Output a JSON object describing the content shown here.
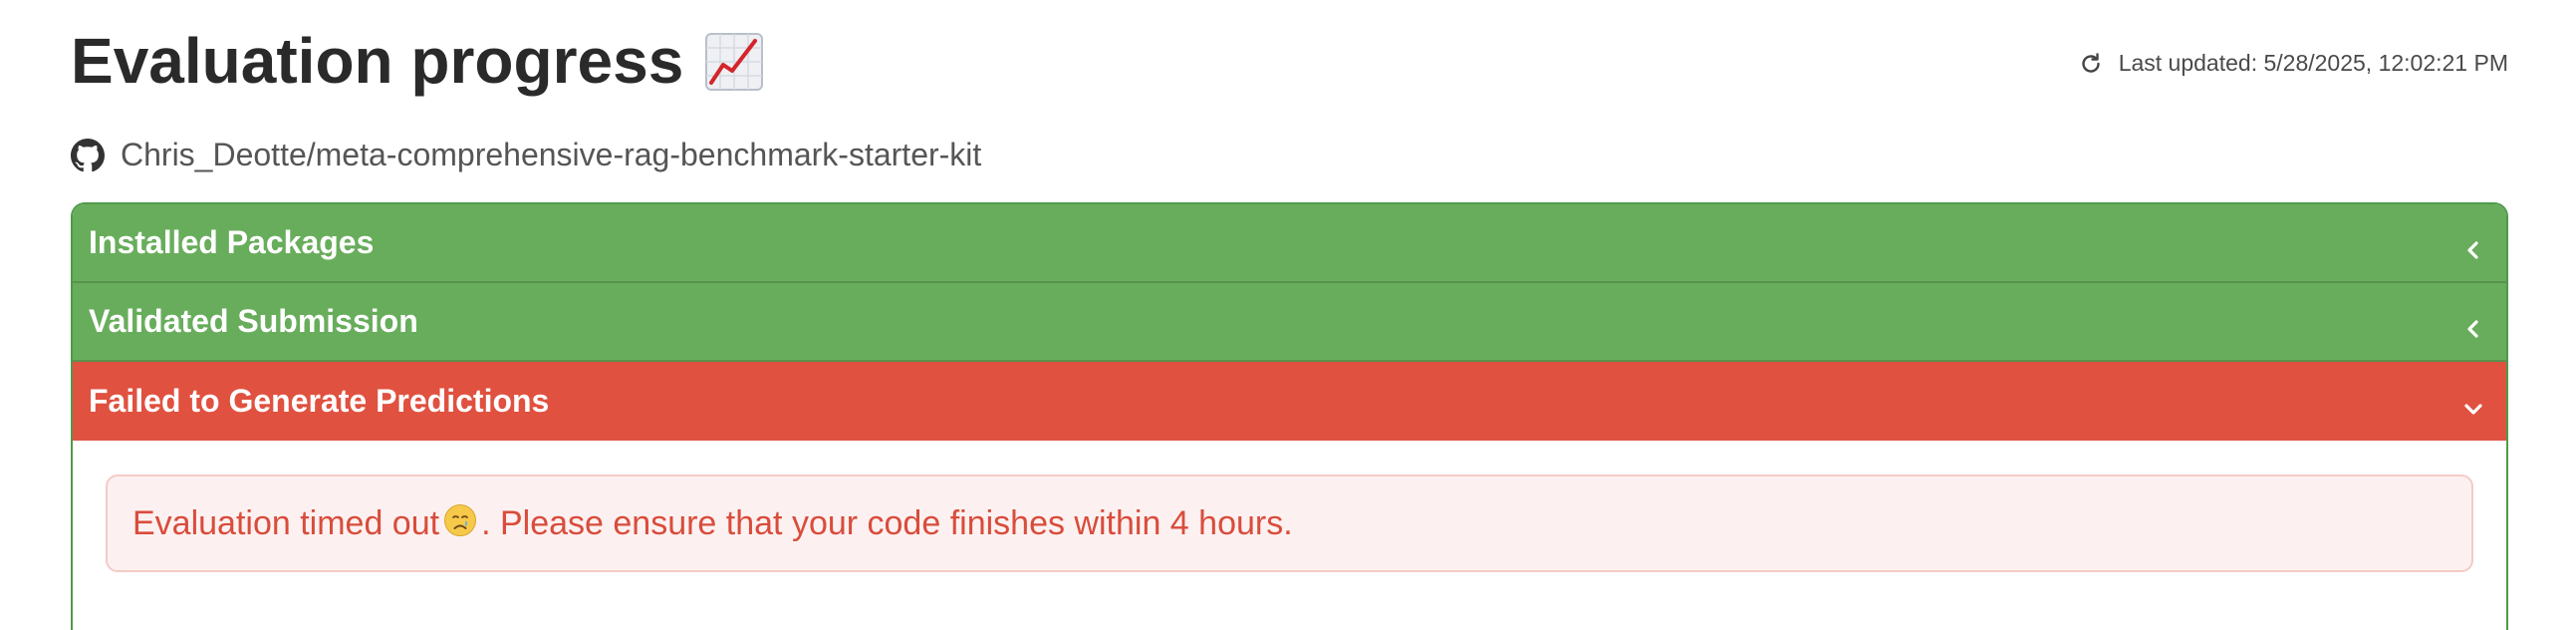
{
  "header": {
    "title": "Evaluation progress",
    "title_icon": "chart-increasing-icon",
    "last_updated_label": "Last updated: 5/28/2025, 12:02:21 PM"
  },
  "repo": {
    "icon": "github-icon",
    "name": "Chris_Deotte/meta-comprehensive-rag-benchmark-starter-kit"
  },
  "stages": [
    {
      "label": "Installed Packages",
      "status": "success",
      "expanded": false
    },
    {
      "label": "Validated Submission",
      "status": "success",
      "expanded": false
    },
    {
      "label": "Failed to Generate Predictions",
      "status": "failure",
      "expanded": true
    }
  ],
  "alert": {
    "text_before": "Evaluation timed out",
    "emoji": "crying-face-icon",
    "text_after": ". Please ensure that your code finishes within 4 hours."
  },
  "colors": {
    "success": "#68ad5c",
    "failure": "#e05140",
    "alert_bg": "#fcf1f0",
    "alert_text": "#d94c3c"
  }
}
